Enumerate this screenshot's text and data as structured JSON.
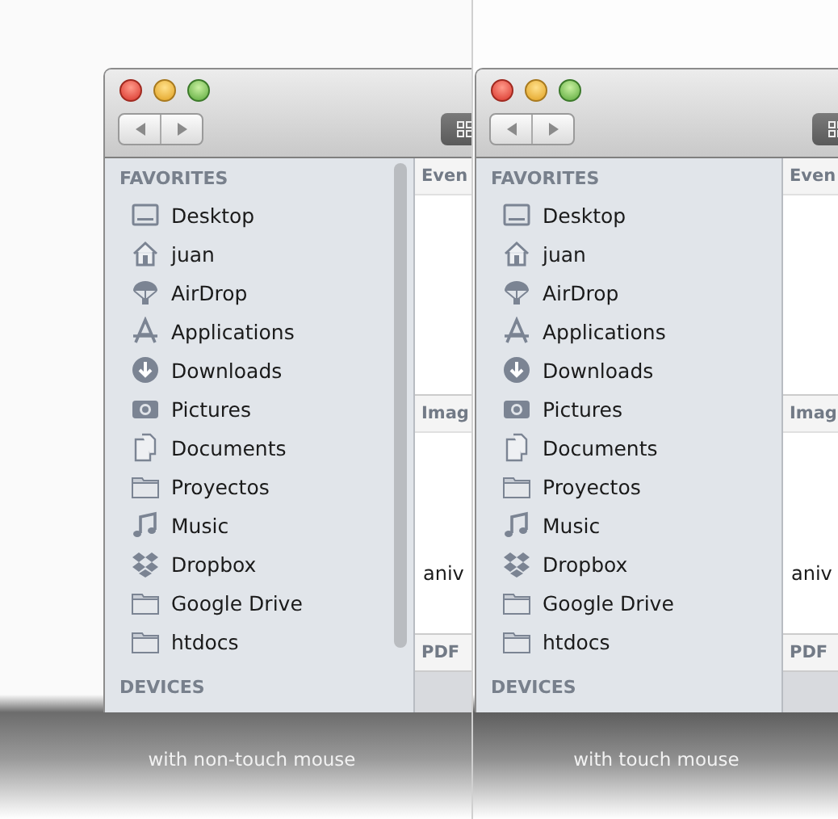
{
  "panels": [
    {
      "caption": "with non-touch mouse",
      "scrollbar_visible": true,
      "sidebar": [
        {
          "heading": "FAVORITES",
          "items": [
            {
              "label": "Desktop",
              "kind": "desktop"
            },
            {
              "label": "juan",
              "kind": "home"
            },
            {
              "label": "AirDrop",
              "kind": "airdrop"
            },
            {
              "label": "Applications",
              "kind": "applications"
            },
            {
              "label": "Downloads",
              "kind": "downloads"
            },
            {
              "label": "Pictures",
              "kind": "pictures"
            },
            {
              "label": "Documents",
              "kind": "documents"
            },
            {
              "label": "Proyectos",
              "kind": "folder"
            },
            {
              "label": "Music",
              "kind": "music"
            },
            {
              "label": "Dropbox",
              "kind": "dropbox"
            },
            {
              "label": "Google Drive",
              "kind": "folder"
            },
            {
              "label": "htdocs",
              "kind": "folder"
            }
          ]
        },
        {
          "heading": "DEVICES"
        }
      ],
      "content_sections": [
        {
          "heading": "Even"
        },
        {
          "heading": "Imag",
          "file_label": "aniv"
        },
        {
          "heading": "PDF"
        }
      ]
    },
    {
      "caption": "with touch mouse",
      "scrollbar_visible": false,
      "sidebar": [
        {
          "heading": "FAVORITES",
          "items": [
            {
              "label": "Desktop",
              "kind": "desktop"
            },
            {
              "label": "juan",
              "kind": "home"
            },
            {
              "label": "AirDrop",
              "kind": "airdrop"
            },
            {
              "label": "Applications",
              "kind": "applications"
            },
            {
              "label": "Downloads",
              "kind": "downloads"
            },
            {
              "label": "Pictures",
              "kind": "pictures"
            },
            {
              "label": "Documents",
              "kind": "documents"
            },
            {
              "label": "Proyectos",
              "kind": "folder"
            },
            {
              "label": "Music",
              "kind": "music"
            },
            {
              "label": "Dropbox",
              "kind": "dropbox"
            },
            {
              "label": "Google Drive",
              "kind": "folder"
            },
            {
              "label": "htdocs",
              "kind": "folder"
            }
          ]
        },
        {
          "heading": "DEVICES"
        }
      ],
      "content_sections": [
        {
          "heading": "Even"
        },
        {
          "heading": "Imag",
          "file_label": "aniv"
        },
        {
          "heading": "PDF"
        }
      ]
    }
  ]
}
